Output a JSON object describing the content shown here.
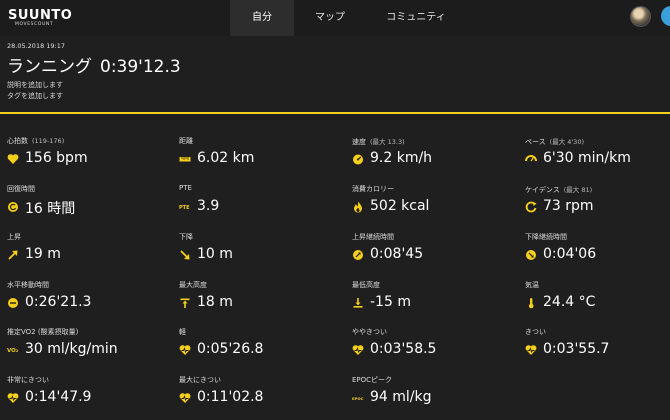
{
  "brand": {
    "name": "SUUNTO",
    "sub": "MOVESCOUNT"
  },
  "nav": {
    "tabs": [
      "自分",
      "マップ",
      "コミュニティ"
    ],
    "active": 0
  },
  "header": {
    "date": "28.05.2018 19:17",
    "activity": "ランニング",
    "duration": "0:39'12.3",
    "add_description": "説明を追加します",
    "add_tags": "タグを追加します"
  },
  "colors": {
    "accent": "#f5cf1b",
    "background": "#1f1f1f"
  },
  "stats": [
    {
      "label": "心拍数",
      "sub": "(119-176)",
      "value": "156 bpm",
      "icon": "heart-icon"
    },
    {
      "label": "距離",
      "sub": "",
      "value": "6.02 km",
      "icon": "ruler-icon"
    },
    {
      "label": "速度",
      "sub": "(最大  13.3)",
      "value": "9.2 km/h",
      "icon": "speedometer-icon"
    },
    {
      "label": "ペース",
      "sub": "(最大  4'30)",
      "value": "6'30 min/km",
      "icon": "pace-gauge-icon"
    },
    {
      "label": "回復時間",
      "sub": "",
      "value": "16 時間",
      "icon": "recovery-icon"
    },
    {
      "label": "PTE",
      "sub": "",
      "value": "3.9",
      "icon": "pte-icon",
      "badge": "PTE"
    },
    {
      "label": "消費カロリー",
      "sub": "",
      "value": "502 kcal",
      "icon": "flame-icon"
    },
    {
      "label": "ケイデンス",
      "sub": "(最大  81)",
      "value": "73 rpm",
      "icon": "cadence-icon"
    },
    {
      "label": "上昇",
      "sub": "",
      "value": "19 m",
      "icon": "arrow-up-right-icon"
    },
    {
      "label": "下降",
      "sub": "",
      "value": "10 m",
      "icon": "arrow-down-right-icon"
    },
    {
      "label": "上昇継続時間",
      "sub": "",
      "value": "0:08'45",
      "icon": "ascent-time-icon"
    },
    {
      "label": "下降継続時間",
      "sub": "",
      "value": "0:04'06",
      "icon": "descent-time-icon"
    },
    {
      "label": "水平移動時間",
      "sub": "",
      "value": "0:26'21.3",
      "icon": "flat-time-icon"
    },
    {
      "label": "最大高度",
      "sub": "",
      "value": "18 m",
      "icon": "max-altitude-icon"
    },
    {
      "label": "最低高度",
      "sub": "",
      "value": "-15 m",
      "icon": "min-altitude-icon"
    },
    {
      "label": "気温",
      "sub": "",
      "value": "24.4 °C",
      "icon": "temperature-icon"
    },
    {
      "label": "推定VO2 (酸素摂取量)",
      "sub": "",
      "value": "30 ml/kg/min",
      "icon": "vo2-icon",
      "badge": "VO₂"
    },
    {
      "label": "軽",
      "sub": "",
      "value": "0:05'26.8",
      "icon": "heart-zone-icon"
    },
    {
      "label": "ややきつい",
      "sub": "",
      "value": "0:03'58.5",
      "icon": "heart-zone-icon"
    },
    {
      "label": "きつい",
      "sub": "",
      "value": "0:03'55.7",
      "icon": "heart-zone-icon"
    },
    {
      "label": "非常にきつい",
      "sub": "",
      "value": "0:14'47.9",
      "icon": "heart-zone-icon"
    },
    {
      "label": "最大にきつい",
      "sub": "",
      "value": "0:11'02.8",
      "icon": "heart-zone-icon"
    },
    {
      "label": "EPOCピーク",
      "sub": "",
      "value": "94 ml/kg",
      "icon": "epoc-icon",
      "badge": "EPOC"
    }
  ]
}
